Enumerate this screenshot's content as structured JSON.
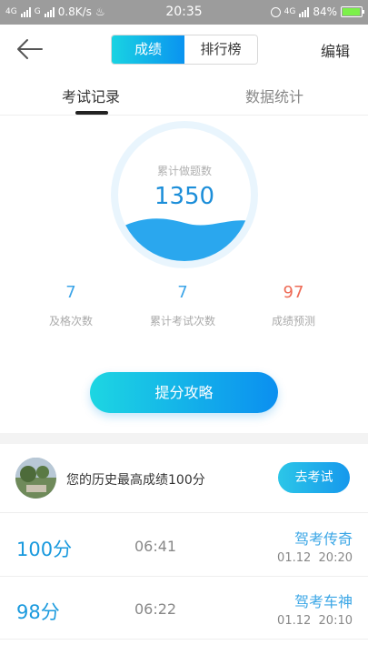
{
  "status_bar": {
    "net1": "4G",
    "net2": "G",
    "speed": "0.8K/s",
    "time": "20:35",
    "net3": "4G",
    "battery": "84%"
  },
  "header": {
    "segments": [
      "成绩",
      "排行榜"
    ],
    "active_segment": "成绩",
    "edit_label": "编辑"
  },
  "tabs": [
    "考试记录",
    "数据统计"
  ],
  "gauge": {
    "label": "累计做题数",
    "value": "1350",
    "fill_fraction": 0.33
  },
  "stats": [
    {
      "value": "7",
      "label": "及格次数"
    },
    {
      "value": "7",
      "label": "累计考试次数"
    },
    {
      "value": "97",
      "label": "成绩预测"
    }
  ],
  "cta_label": "提分攻略",
  "best": {
    "text": "您的历史最高成绩100分",
    "button": "去考试"
  },
  "records": [
    {
      "score": "100分",
      "duration": "06:41",
      "title": "驾考传奇",
      "date": "01.12",
      "time": "20:20"
    },
    {
      "score": "98分",
      "duration": "06:22",
      "title": "驾考车神",
      "date": "01.12",
      "time": "20:10"
    }
  ],
  "colors": {
    "accent": "#0b8ff0",
    "accent_light": "#1dd6e2",
    "prediction": "#ee6a55",
    "status_bar": "#9c9c9c"
  }
}
